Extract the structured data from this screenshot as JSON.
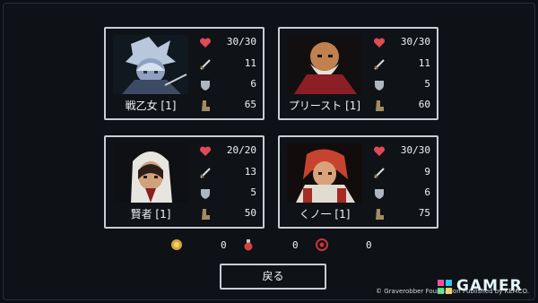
{
  "party": [
    {
      "name": "戦乙女 [1]",
      "hp": "30/30",
      "atk": "11",
      "def": "6",
      "spd": "65"
    },
    {
      "name": "プリースト [1]",
      "hp": "30/30",
      "atk": "11",
      "def": "5",
      "spd": "60"
    },
    {
      "name": "賢者 [1]",
      "hp": "20/20",
      "atk": "13",
      "def": "5",
      "spd": "50"
    },
    {
      "name": "くノ一 [1]",
      "hp": "30/30",
      "atk": "9",
      "def": "6",
      "spd": "75"
    }
  ],
  "items": [
    {
      "icon": "coin-icon",
      "value": "0"
    },
    {
      "icon": "potion-icon",
      "value": "0"
    },
    {
      "icon": "rune-icon",
      "value": "0"
    }
  ],
  "back_label": "戻る",
  "icons": {
    "hp": "heart-icon",
    "atk": "sword-icon",
    "def": "shield-icon",
    "spd": "boot-icon"
  },
  "colors": {
    "heart": "#e04a57",
    "frame": "#c9ced4",
    "background": "#0e1115",
    "text": "#f1f3f5"
  },
  "watermark": {
    "brand": "GAMER",
    "copyright": "© Graverobber Foundation Published by KEMCO."
  }
}
